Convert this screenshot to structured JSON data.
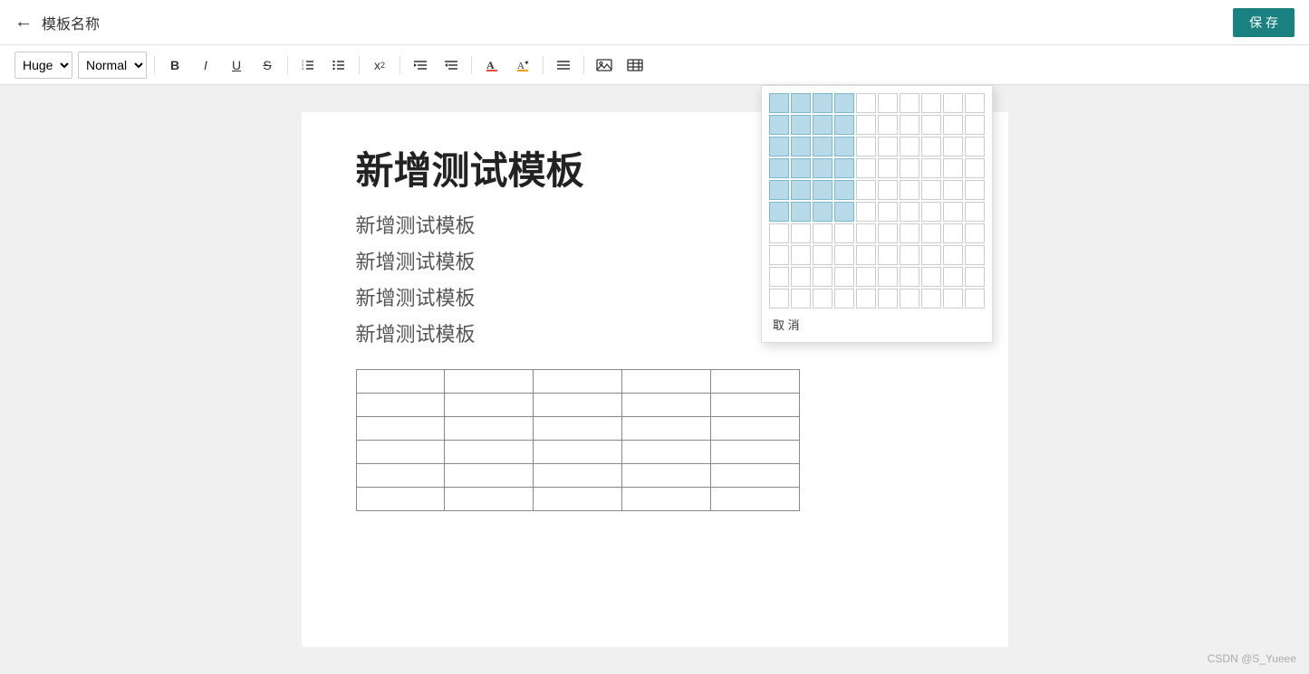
{
  "header": {
    "back_label": "←",
    "title": "模板名称",
    "save_label": "保 存"
  },
  "toolbar": {
    "font_size_label": "Huge",
    "font_style_label": "Normal",
    "bold_label": "B",
    "italic_label": "I",
    "underline_label": "U",
    "strikethrough_label": "S",
    "ordered_list_label": "≡",
    "unordered_list_label": "≡",
    "superscript_label": "x²",
    "indent_right_label": "⇥",
    "indent_left_label": "⇤",
    "font_color_label": "A",
    "highlight_label": "✦",
    "align_label": "≡",
    "image_label": "⬜",
    "table_label": "⊞"
  },
  "table_picker": {
    "cancel_label": "取 消",
    "rows": 10,
    "cols": 10,
    "highlighted_rows": 6,
    "highlighted_cols": 4
  },
  "editor": {
    "title": "新增测试模板",
    "lines": [
      "新增测试模板",
      "新增测试模板",
      "新增测试模板",
      "新增测试模板"
    ],
    "table": {
      "rows": 6,
      "cols": 5
    }
  },
  "watermark": {
    "text": "CSDN @S_Yueee"
  }
}
